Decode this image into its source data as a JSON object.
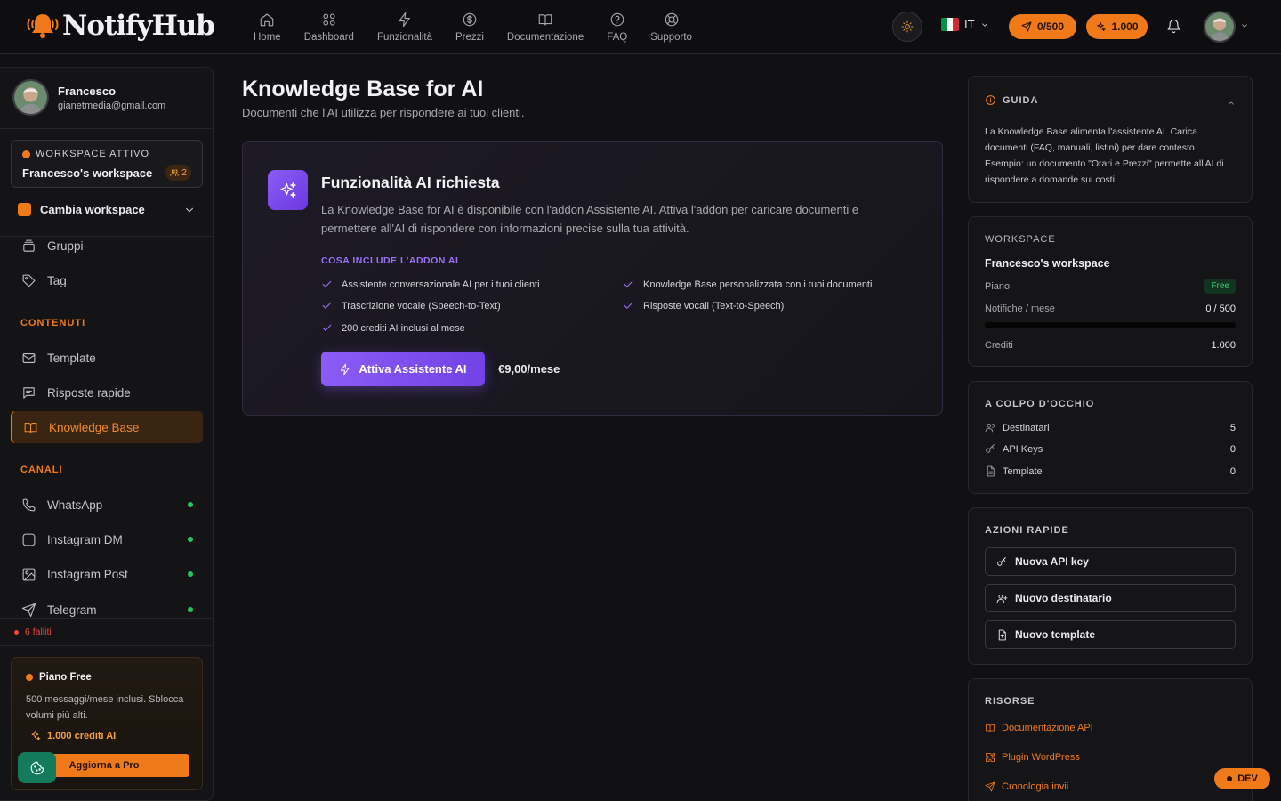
{
  "app": {
    "logo": "NotifyHub"
  },
  "nav": [
    {
      "label": "Home",
      "icon": "home-icon"
    },
    {
      "label": "Dashboard",
      "icon": "dashboard-icon"
    },
    {
      "label": "Funzionalità",
      "icon": "bolt-icon"
    },
    {
      "label": "Prezzi",
      "icon": "dollar-icon"
    },
    {
      "label": "Documentazione",
      "icon": "book-icon"
    },
    {
      "label": "FAQ",
      "icon": "help-icon"
    },
    {
      "label": "Supporto",
      "icon": "lifebuoy-icon"
    }
  ],
  "header": {
    "lang": "IT",
    "notifications_counter": "0/500",
    "credits": "1.000"
  },
  "sidebar": {
    "user": {
      "name": "Francesco",
      "email": "gianetmedia@gmail.com"
    },
    "workspace": {
      "label": "WORKSPACE ATTIVO",
      "name": "Francesco's workspace",
      "members": "2"
    },
    "switch_label": "Cambia workspace",
    "items_top": [
      {
        "label": "Gruppi"
      },
      {
        "label": "Tag"
      }
    ],
    "section_contenuti": "CONTENUTI",
    "items_contenuti": [
      {
        "label": "Template"
      },
      {
        "label": "Risposte rapide"
      },
      {
        "label": "Knowledge Base"
      }
    ],
    "section_canali": "CANALI",
    "items_canali": [
      {
        "label": "WhatsApp"
      },
      {
        "label": "Instagram DM"
      },
      {
        "label": "Instagram Post"
      },
      {
        "label": "Telegram"
      }
    ],
    "failed": "6 falliti",
    "plan": {
      "title": "Piano Free",
      "desc": "500 messaggi/mese inclusi. Sblocca volumi più alti.",
      "credits": "1.000 crediti AI",
      "cta": "Aggiorna a Pro"
    }
  },
  "main": {
    "title": "Knowledge Base for AI",
    "subtitle": "Documenti che l'AI utilizza per rispondere ai tuoi clienti.",
    "card": {
      "title": "Funzionalità AI richiesta",
      "desc": "La Knowledge Base for AI è disponibile con l'addon Assistente AI. Attiva l'addon per caricare documenti e permettere all'AI di rispondere con informazioni precise sulla tua attività.",
      "includes_label": "COSA INCLUDE L'ADDON AI",
      "features": [
        "Assistente conversazionale AI per i tuoi clienti",
        "Knowledge Base personalizzata con i tuoi documenti",
        "Trascrizione vocale (Speech-to-Text)",
        "Risposte vocali (Text-to-Speech)",
        "200 crediti AI inclusi al mese"
      ],
      "cta": "Attiva Assistente AI",
      "price": "€9,00/mese"
    }
  },
  "right": {
    "guide": {
      "label": "GUIDA",
      "text": "La Knowledge Base alimenta l'assistente AI. Carica documenti (FAQ, manuali, listini) per dare contesto. Esempio: un documento \"Orari e Prezzi\" permette all'AI di rispondere a domande sui costi."
    },
    "workspace": {
      "label": "WORKSPACE",
      "name": "Francesco's workspace",
      "plan_label": "Piano",
      "plan_value": "Free",
      "notif_label": "Notifiche / mese",
      "notif_value": "0 / 500",
      "notif_usage_fraction": 0,
      "credits_label": "Crediti",
      "credits_value": "1.000"
    },
    "glance": {
      "label": "A COLPO D'OCCHIO",
      "rows": [
        {
          "label": "Destinatari",
          "value": "5"
        },
        {
          "label": "API Keys",
          "value": "0"
        },
        {
          "label": "Template",
          "value": "0"
        }
      ]
    },
    "quick": {
      "label": "AZIONI RAPIDE",
      "buttons": [
        "Nuova API key",
        "Nuovo destinatario",
        "Nuovo template"
      ]
    },
    "resources": {
      "label": "RISORSE",
      "links": [
        "Documentazione API",
        "Plugin WordPress",
        "Cronologia invii"
      ]
    }
  },
  "dev_badge": "DEV",
  "colors": {
    "accent": "#f07a1a",
    "ai_purple": "#8b5cf6",
    "success": "#22c55e",
    "danger": "#ef4444"
  }
}
